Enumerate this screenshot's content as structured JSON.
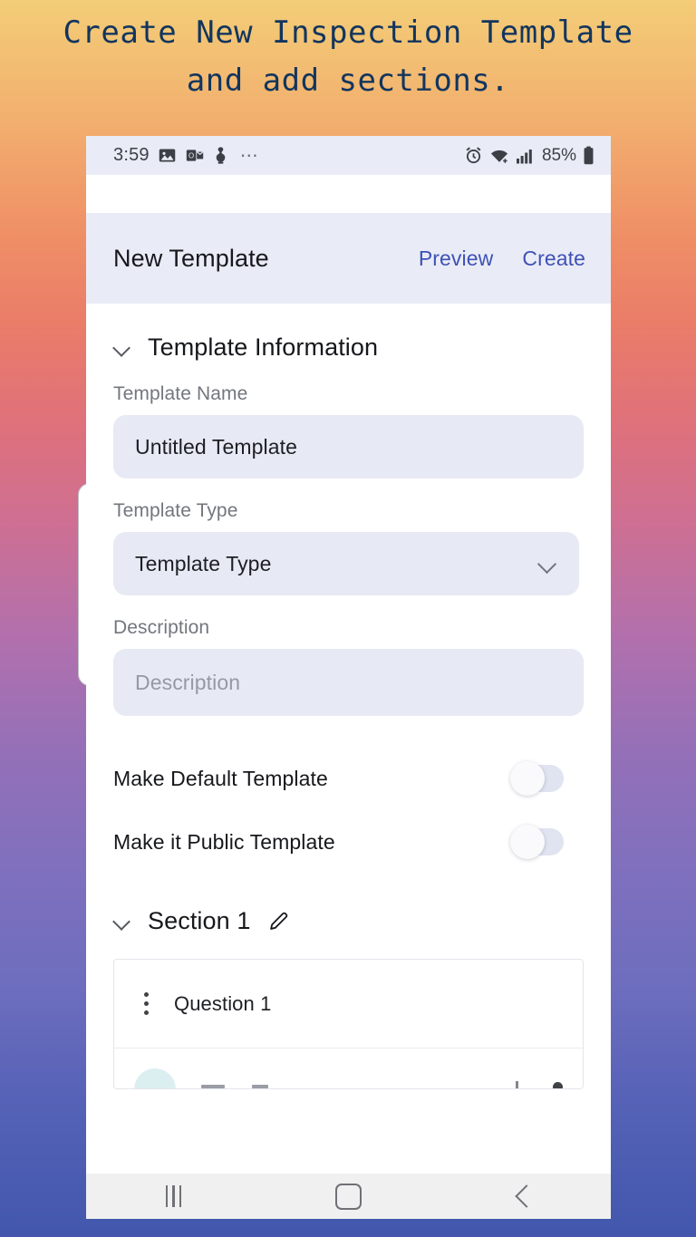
{
  "caption": {
    "text": "Create New Inspection Template\nand add sections."
  },
  "theme": {
    "gradient_top": "#f3cd77",
    "gradient_mid": "#cf6f92",
    "gradient_bottom": "#4257ac",
    "caption_color": "#12355e",
    "accent_blue": "#3f51b5",
    "field_bg": "#e7eaf4",
    "bar_bg": "#e9ecf6",
    "teal": "#107a80"
  },
  "status_bar": {
    "clock": "3:59",
    "icons": [
      "image-icon",
      "outlook-icon",
      "app-icon"
    ],
    "overflow": "⋯",
    "right_icons": [
      "alarm-icon",
      "wifi-icon",
      "cellular-signal-icon"
    ],
    "battery_percent": "85%"
  },
  "app_bar": {
    "title": "New Template",
    "preview_label": "Preview",
    "create_label": "Create"
  },
  "template_information": {
    "section_title": "Template Information",
    "expanded": true,
    "fields": [
      {
        "label": "Template Name",
        "value": "Untitled Template",
        "placeholder": "Template Name",
        "type": "text"
      },
      {
        "label": "Template Type",
        "value": "Template Type",
        "placeholder": "Template Type",
        "type": "select"
      },
      {
        "label": "Description",
        "value": "",
        "placeholder": "Description",
        "type": "textarea"
      }
    ],
    "toggles": [
      {
        "label": "Make Default Template",
        "on": false
      },
      {
        "label": "Make it Public Template",
        "on": false
      }
    ]
  },
  "section_1": {
    "title": "Section 1",
    "expanded": true,
    "edit_icon": "pencil-icon",
    "questions": [
      {
        "label": "Question 1",
        "handle": "drag-handle-icon"
      }
    ]
  },
  "nav_bar": {
    "recents_label": "Recents",
    "home_label": "Home",
    "back_label": "Back"
  }
}
